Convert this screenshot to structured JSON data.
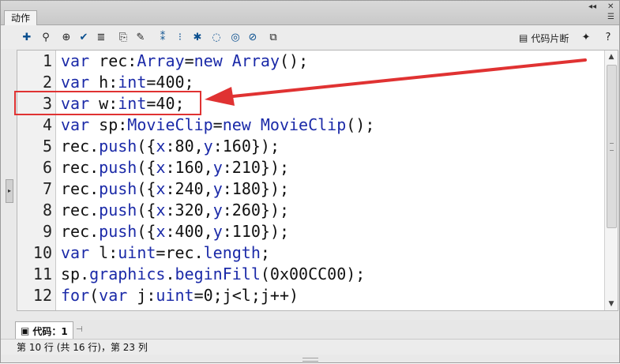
{
  "panel": {
    "tab_label": "动作",
    "collapse_glyph": "◂◂",
    "close_glyph": "✕",
    "menu_glyph": "☰"
  },
  "toolbar": {
    "icons": [
      "add-statement-icon",
      "find-icon",
      "target-icon",
      "check-syntax-icon",
      "auto-format-icon",
      "code-hint-icon",
      "debug-options-icon",
      "collapse-between-braces-icon",
      "collapse-selection-icon",
      "expand-all-icon",
      "apply-block-comment-icon",
      "apply-line-comment-icon",
      "remove-comment-icon",
      "show-hide-toolbox-icon"
    ],
    "snippets_label": "代码片断",
    "wand_icon": "magic-wand-icon",
    "help_icon": "help-icon"
  },
  "editor": {
    "line_numbers": [
      "1",
      "2",
      "3",
      "4",
      "5",
      "6",
      "7",
      "8",
      "9",
      "10",
      "11",
      "12"
    ],
    "lines": [
      "var rec:Array=new Array();",
      "var h:int=400;",
      "var w:int=40;",
      "var sp:MovieClip=new MovieClip();",
      "rec.push({x:80,y:160});",
      "rec.push({x:160,y:210});",
      "rec.push({x:240,y:180});",
      "rec.push({x:320,y:260});",
      "rec.push({x:400,y:110});",
      "var l:uint=rec.length;",
      "sp.graphics.beginFill(0x00CC00);",
      "for(var j:uint=0;j<l;j++)"
    ],
    "highlighted_line": "3"
  },
  "footer": {
    "code_tab_label": "代码：1",
    "status_text": "第 10 行 (共 16 行)，第 23 列"
  },
  "colors": {
    "keyword": "#1b2aa8",
    "annotation": "#e03232"
  }
}
